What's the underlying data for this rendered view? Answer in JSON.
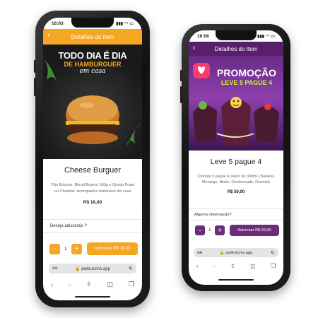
{
  "phones": [
    {
      "time": "16:03",
      "header_title": "Detalhes do Item",
      "header_color": "#f5a623",
      "banner_line1": "TODO DIA É DIA",
      "banner_line2": "DE HAMBURGUER",
      "banner_line3": "em casa",
      "product_title": "Cheese Burguer",
      "description": "Pão Brioche, Blend Bovino 160g e Queijo Prato ou Cheddar. Acompanha maionese da casa",
      "price": "R$ 16,00",
      "section_label": "Deseja adicionais ?",
      "qty_minus": "-",
      "qty_value": "1",
      "qty_plus": "+",
      "add_label": "Adicionar  R$ 16,00",
      "url_aa": "AA",
      "url": "pede.kcms.app",
      "accent": "#f5a623"
    },
    {
      "time": "16:08",
      "header_title": "Detalhes do Item",
      "header_color": "#5a1f6b",
      "banner_line1": "PROMOÇÃO",
      "banner_line2": "LEVE 5 PAGUE 4",
      "product_title": "Leve 5 pague 4",
      "description": "Compre 5 pague 4 copos de 300ml ( Banana, Morango, Ninho, Condensado, Granola)",
      "price": "R$ 50,00",
      "section_label": "Alguma observação?",
      "qty_minus": "-",
      "qty_value": "1",
      "qty_plus": "+",
      "add_label": "Adicionar  R$ 50,00",
      "url_aa": "AA",
      "url": "pede.kcms.app",
      "accent": "#6b2d7a"
    }
  ],
  "toolbar_icons": [
    "back-icon",
    "forward-icon",
    "share-icon",
    "bookmarks-icon",
    "tabs-icon"
  ]
}
